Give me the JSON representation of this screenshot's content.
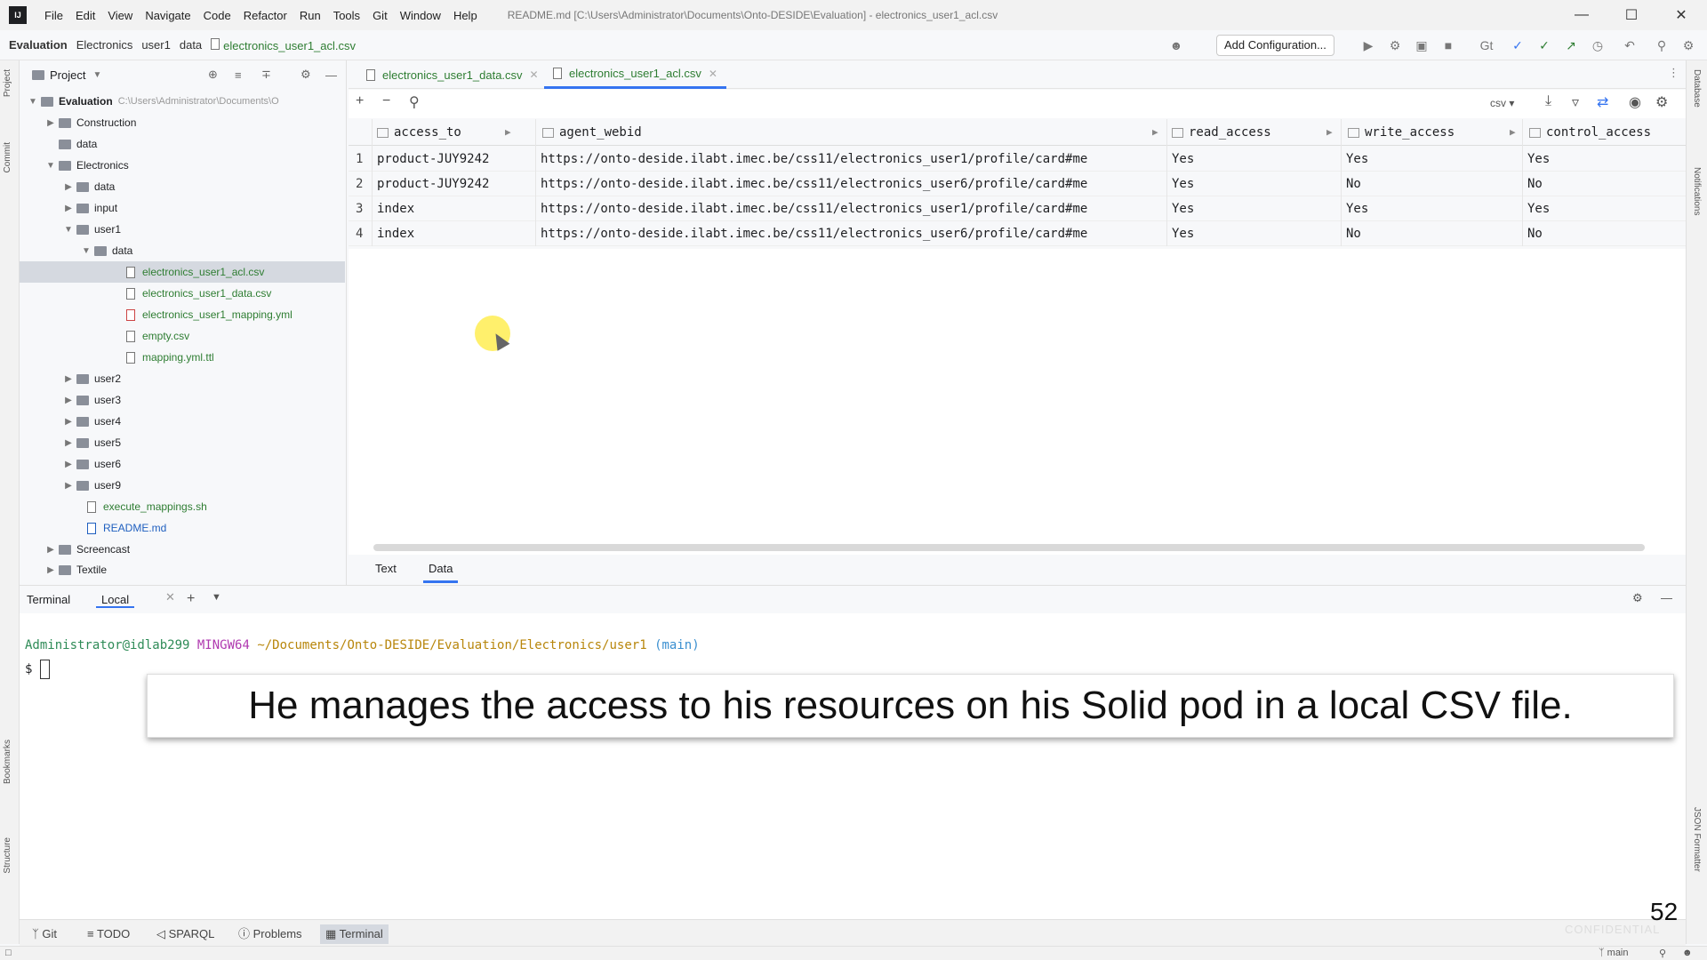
{
  "titlebar": {
    "menu": [
      "File",
      "Edit",
      "View",
      "Navigate",
      "Code",
      "Refactor",
      "Run",
      "Tools",
      "Git",
      "Window",
      "Help"
    ],
    "window_title": "README.md [C:\\Users\\Administrator\\Documents\\Onto-DESIDE\\Evaluation] - electronics_user1_acl.csv",
    "minimize": "—",
    "maximize": "☐",
    "close": "✕"
  },
  "navbar": {
    "crumbs": [
      "Evaluation",
      "Electronics",
      "user1",
      "data"
    ],
    "file": "electronics_user1_acl.csv",
    "add_config": "Add Configuration..."
  },
  "project": {
    "title": "Project",
    "root_label": "Evaluation",
    "root_path": "C:\\Users\\Administrator\\Documents\\O",
    "items": [
      {
        "label": "Construction"
      },
      {
        "label": "data"
      },
      {
        "label": "Electronics"
      },
      {
        "label": "data"
      },
      {
        "label": "input"
      },
      {
        "label": "user1"
      },
      {
        "label": "data"
      },
      {
        "label": "electronics_user1_acl.csv"
      },
      {
        "label": "electronics_user1_data.csv"
      },
      {
        "label": "electronics_user1_mapping.yml"
      },
      {
        "label": "empty.csv"
      },
      {
        "label": "mapping.yml.ttl"
      },
      {
        "label": "user2"
      },
      {
        "label": "user3"
      },
      {
        "label": "user4"
      },
      {
        "label": "user5"
      },
      {
        "label": "user6"
      },
      {
        "label": "user9"
      },
      {
        "label": "execute_mappings.sh"
      },
      {
        "label": "README.md"
      },
      {
        "label": "Screencast"
      },
      {
        "label": "Textile"
      }
    ]
  },
  "editor": {
    "tabs": [
      {
        "label": "electronics_user1_data.csv"
      },
      {
        "label": "electronics_user1_acl.csv"
      }
    ],
    "format": "csv",
    "columns": [
      "access_to",
      "agent_webid",
      "read_access",
      "write_access",
      "control_access"
    ],
    "rows": [
      {
        "n": "1",
        "access_to": "product-JUY9242",
        "agent_webid": "https://onto-deside.ilabt.imec.be/css11/electronics_user1/profile/card#me",
        "read": "Yes",
        "write": "Yes",
        "control": "Yes"
      },
      {
        "n": "2",
        "access_to": "product-JUY9242",
        "agent_webid": "https://onto-deside.ilabt.imec.be/css11/electronics_user6/profile/card#me",
        "read": "Yes",
        "write": "No",
        "control": "No"
      },
      {
        "n": "3",
        "access_to": "index",
        "agent_webid": "https://onto-deside.ilabt.imec.be/css11/electronics_user1/profile/card#me",
        "read": "Yes",
        "write": "Yes",
        "control": "Yes"
      },
      {
        "n": "4",
        "access_to": "index",
        "agent_webid": "https://onto-deside.ilabt.imec.be/css11/electronics_user6/profile/card#me",
        "read": "Yes",
        "write": "No",
        "control": "No"
      }
    ],
    "bottom_tabs": [
      "Text",
      "Data"
    ]
  },
  "terminal": {
    "title": "Terminal",
    "tab": "Local",
    "prompt_user": "Administrator@idlab299",
    "prompt_host": "MINGW64",
    "prompt_path": "~/Documents/Onto-DESIDE/Evaluation/Electronics/user1",
    "prompt_branch": "(main)",
    "prompt_symbol": "$"
  },
  "caption": "He manages the access to his resources on his Solid pod in a local CSV file.",
  "page_number": "52",
  "watermark": "CONFIDENTIAL",
  "toolwindows": [
    "Git",
    "TODO",
    "SPARQL",
    "Problems",
    "Terminal"
  ],
  "left_strip": [
    "Project",
    "Commit",
    "Bookmarks",
    "Structure"
  ],
  "right_strip": [
    "Database",
    "Notifications",
    "JSON Formatter"
  ],
  "status": {
    "branch": "main"
  },
  "colors": {
    "accent": "#3574f0",
    "file_green": "#2e7d32",
    "caption_bg": "#ffffff",
    "highlight": "#ffeb3b"
  }
}
